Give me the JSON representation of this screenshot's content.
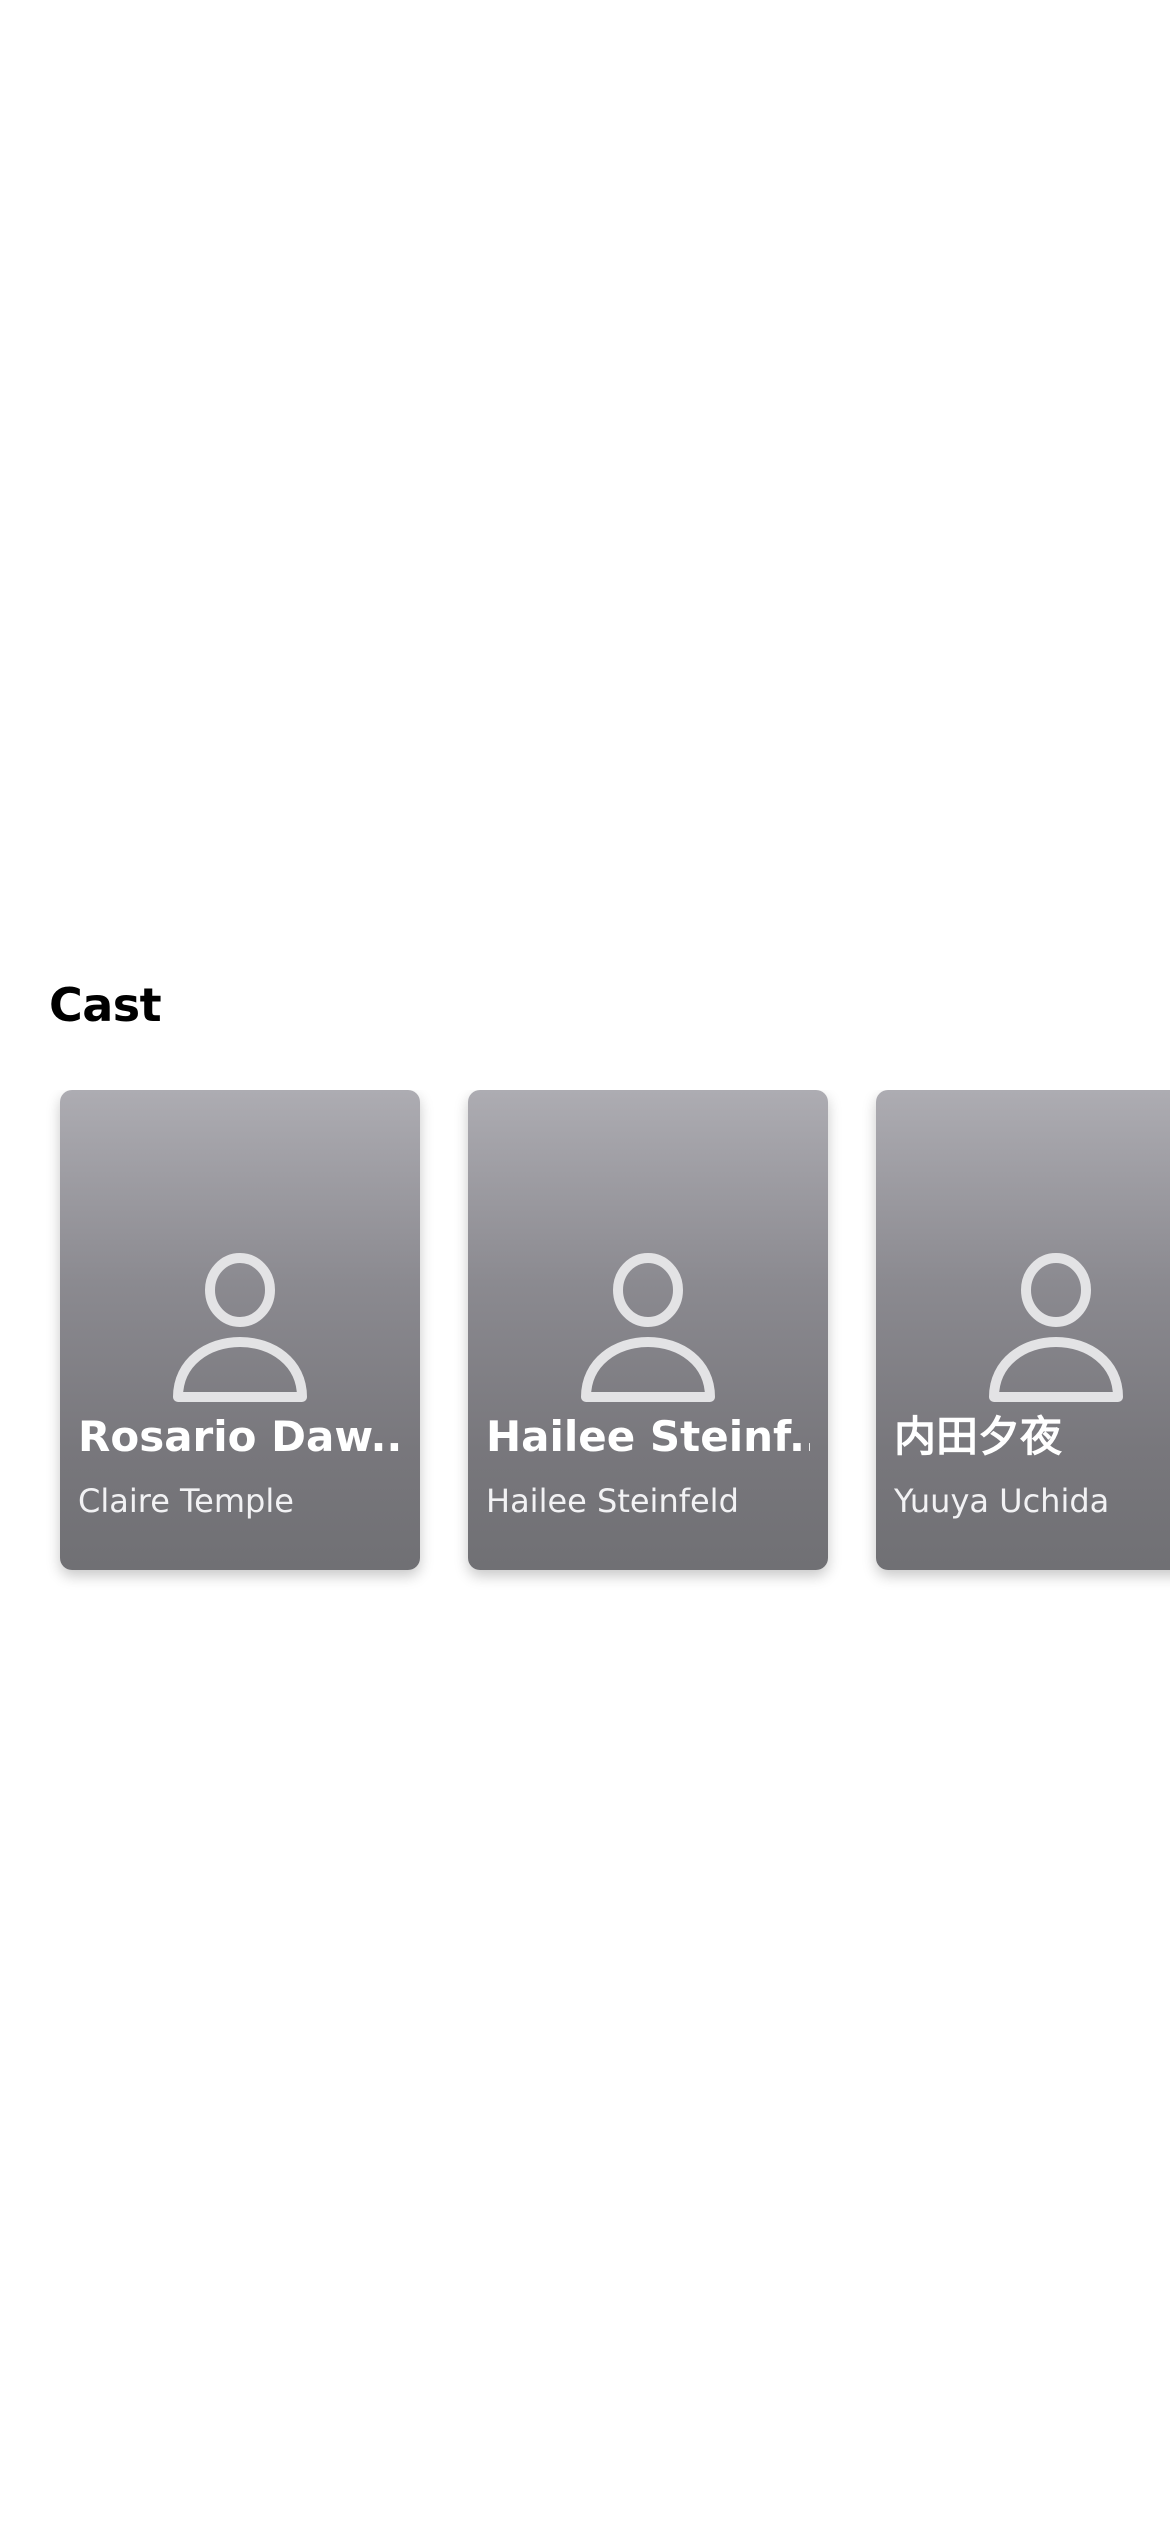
{
  "cast_section": {
    "title": "Cast",
    "members": [
      {
        "name": "Rosario Daw...",
        "character": "Claire Temple",
        "icon": "person-icon"
      },
      {
        "name": "Hailee Steinf...",
        "character": "Hailee Steinfeld",
        "icon": "person-icon"
      },
      {
        "name": "内田夕夜",
        "character": "Yuuya Uchida",
        "icon": "person-icon"
      }
    ]
  },
  "colors": {
    "card_top": "#adacb2",
    "card_bottom": "#707074",
    "icon": "#e3e3e5",
    "title": "#000000"
  }
}
